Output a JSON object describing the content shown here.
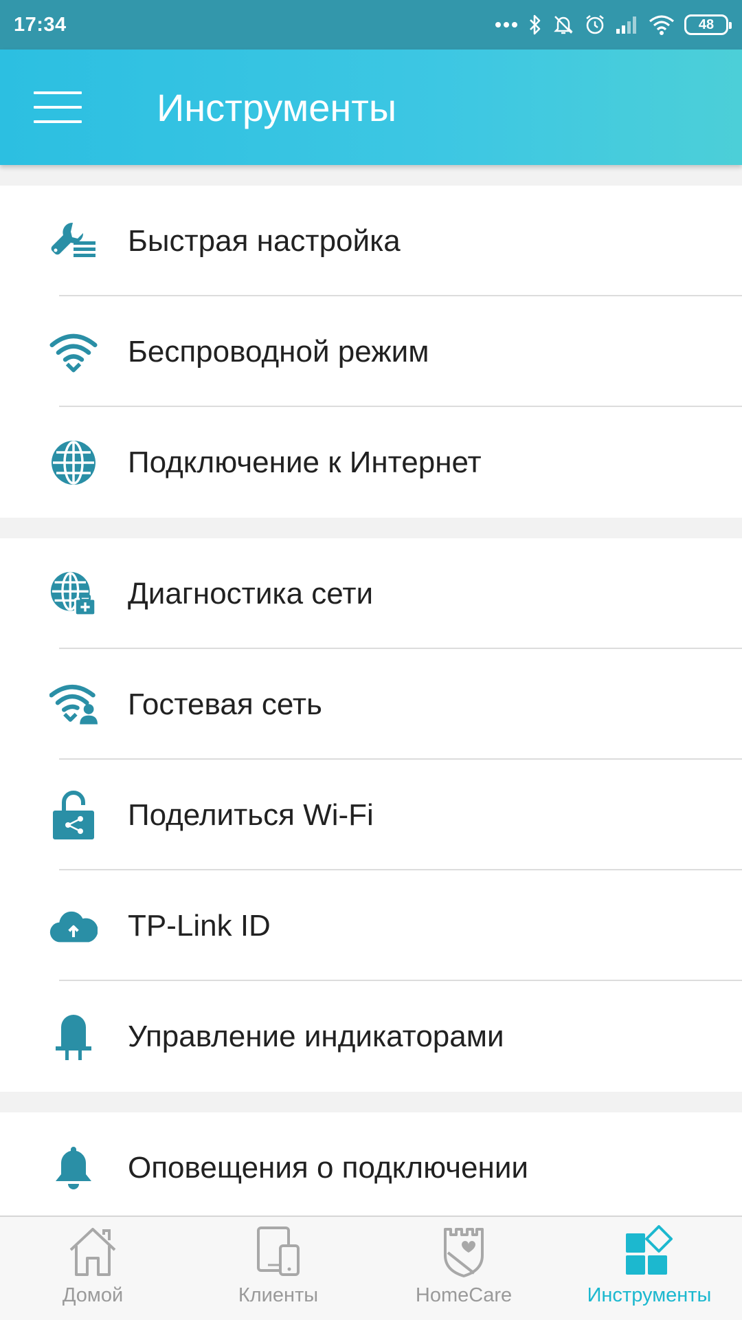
{
  "status_bar": {
    "time": "17:34",
    "battery": "48"
  },
  "app_bar": {
    "title": "Инструменты"
  },
  "groups": [
    {
      "items": [
        {
          "icon": "quick-setup-icon",
          "label": "Быстрая настройка"
        },
        {
          "icon": "wifi-icon",
          "label": "Беспроводной режим"
        },
        {
          "icon": "globe-icon",
          "label": "Подключение к Интернет"
        }
      ]
    },
    {
      "items": [
        {
          "icon": "network-diagnostic-icon",
          "label": "Диагностика сети"
        },
        {
          "icon": "guest-network-icon",
          "label": "Гостевая сеть"
        },
        {
          "icon": "share-wifi-icon",
          "label": "Поделиться Wi-Fi"
        },
        {
          "icon": "cloud-upload-icon",
          "label": "TP-Link ID"
        },
        {
          "icon": "led-icon",
          "label": "Управление индикаторами"
        }
      ]
    },
    {
      "items": [
        {
          "icon": "bell-icon",
          "label": "Оповещения о подключении"
        }
      ]
    }
  ],
  "bottom_nav": [
    {
      "icon": "home-icon",
      "label": "Домой",
      "active": false
    },
    {
      "icon": "clients-icon",
      "label": "Клиенты",
      "active": false
    },
    {
      "icon": "homecare-shield-icon",
      "label": "HomeCare",
      "active": false
    },
    {
      "icon": "tools-icon",
      "label": "Инструменты",
      "active": true
    }
  ],
  "colors": {
    "accent": "#1cb8cf",
    "icon": "#2a8fa6",
    "app_bar": "#3dc7e3",
    "status_bar": "#3397ab"
  }
}
